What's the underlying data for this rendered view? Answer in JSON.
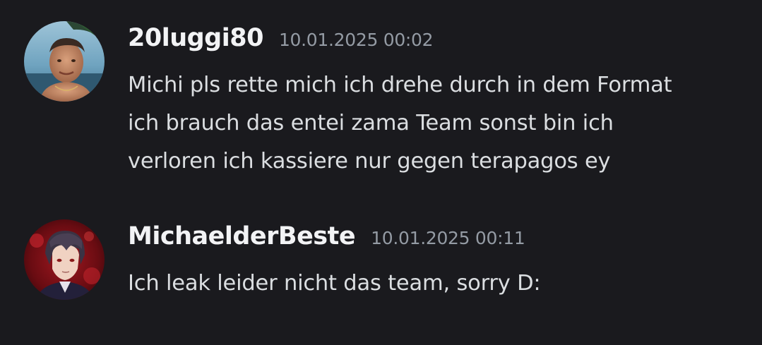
{
  "messages": [
    {
      "username": "20luggi80",
      "timestamp": "10.01.2025 00:02",
      "avatar_icon": "user-avatar-beach-photo",
      "lines": [
        "Michi pls rette mich ich drehe durch in dem Format",
        "ich brauch das entei zama Team sonst bin ich",
        "verloren ich kassiere nur gegen terapagos ey"
      ]
    },
    {
      "username": "MichaelderBeste",
      "timestamp": "10.01.2025 00:11",
      "avatar_icon": "user-avatar-anime-character",
      "lines": [
        "Ich leak leider nicht das team, sorry D:"
      ]
    }
  ],
  "colors": {
    "background": "#1a1a1e",
    "username": "#f2f3f5",
    "timestamp": "#949ba4",
    "message_text": "#dbdee1"
  }
}
